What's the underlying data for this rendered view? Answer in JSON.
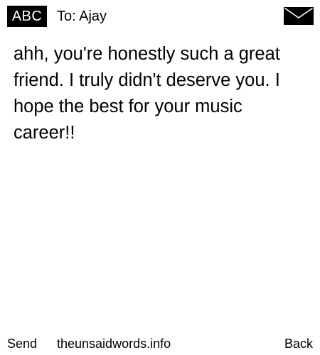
{
  "header": {
    "input_mode": "ABC",
    "recipient": "To: Ajay",
    "envelope_icon": "envelope-icon"
  },
  "message": {
    "body": "ahh, you're honestly such a great friend. I truly didn't deserve you. I hope the best for your music career!!"
  },
  "footer": {
    "send_label": "Send",
    "site_label": "theunsaidwords.info",
    "back_label": "Back"
  },
  "colors": {
    "background": "#ffffff",
    "text": "#000000",
    "badge_bg": "#000000",
    "badge_text": "#ffffff"
  }
}
